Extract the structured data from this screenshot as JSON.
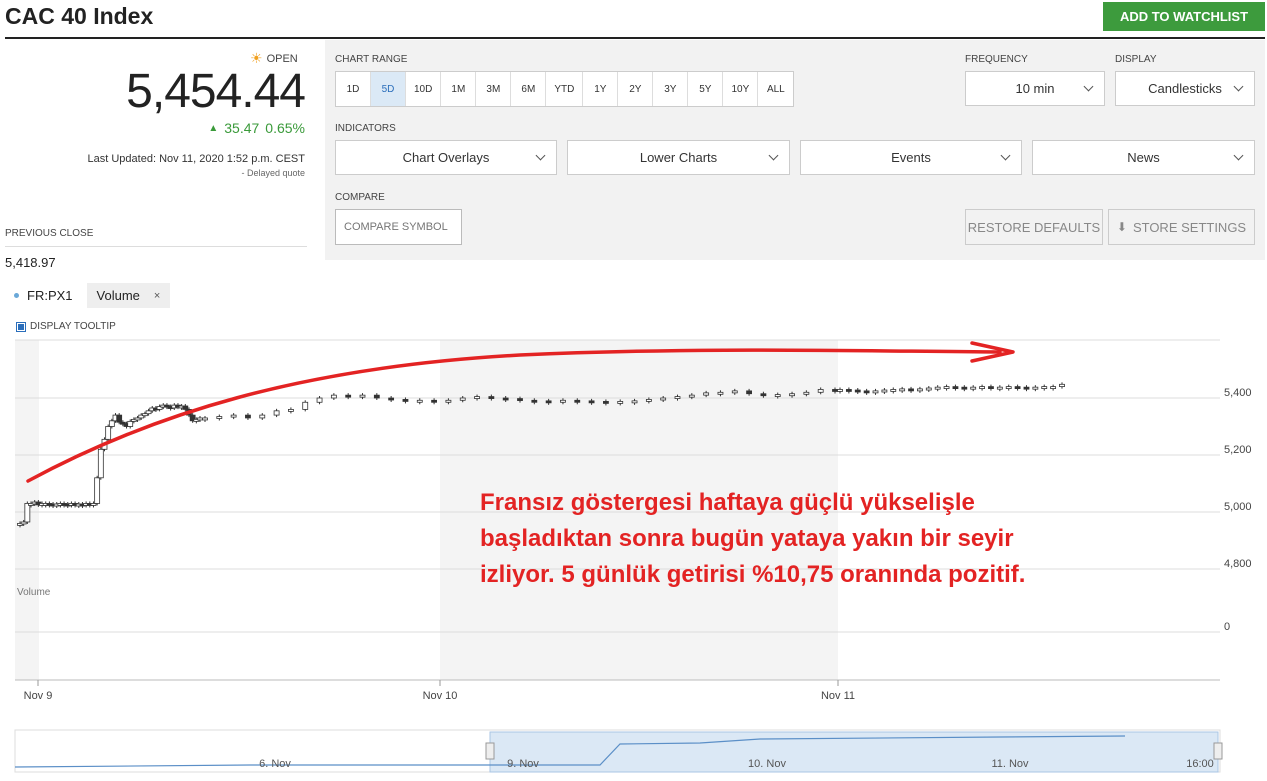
{
  "header": {
    "title": "CAC 40 Index",
    "watchlist_label": "ADD TO WATCHLIST"
  },
  "quote": {
    "status": "OPEN",
    "price": "5,454.44",
    "change": "35.47",
    "change_pct": "0.65%",
    "last_updated": "Last Updated: Nov 11, 2020 1:52 p.m. CEST",
    "delayed": "- Delayed quote",
    "prev_close_label": "PREVIOUS CLOSE",
    "prev_close": "5,418.97"
  },
  "controls": {
    "chart_range_label": "CHART RANGE",
    "ranges": [
      "1D",
      "5D",
      "10D",
      "1M",
      "3M",
      "6M",
      "YTD",
      "1Y",
      "2Y",
      "3Y",
      "5Y",
      "10Y",
      "ALL"
    ],
    "active_range": "5D",
    "frequency_label": "FREQUENCY",
    "frequency": "10 min",
    "display_label": "DISPLAY",
    "display": "Candlesticks",
    "indicators_label": "INDICATORS",
    "indicators": [
      "Chart Overlays",
      "Lower Charts",
      "Events",
      "News"
    ],
    "compare_label": "COMPARE",
    "compare_placeholder": "COMPARE SYMBOL",
    "restore_label": "RESTORE DEFAULTS",
    "store_label": "STORE SETTINGS"
  },
  "legend": {
    "symbol": "FR:PX1",
    "volume": "Volume",
    "close": "×",
    "tooltip": "DISPLAY TOOLTIP"
  },
  "annotation": "Fransız göstergesi haftaya güçlü yükselişle başladıktan sonra bugün yataya yakın bir seyir izliyor. 5 günlük getirisi %10,75 oranında pozitif.",
  "annotation_color": "#e32323",
  "chart_data": {
    "type": "candlestick",
    "y_ticks": [
      "5,400",
      "5,200",
      "5,000",
      "4,800"
    ],
    "ylim": [
      4800,
      5600
    ],
    "x_labels": [
      "Nov 9",
      "Nov 10",
      "Nov 11"
    ],
    "volume_label": "Volume",
    "volume_tick": "0",
    "navigator_labels": [
      "6. Nov",
      "9. Nov",
      "10. Nov",
      "11. Nov",
      "16:00"
    ],
    "series": [
      {
        "name": "Nov 9",
        "values": [
          4960,
          4965,
          5030,
          5030,
          5035,
          5025,
          5030,
          5030,
          5028,
          5025,
          5028,
          5030,
          5028,
          5025,
          5030,
          5026,
          5028,
          5025,
          5030,
          5028,
          5030,
          5120,
          5220,
          5255,
          5300,
          5320,
          5340,
          5315,
          5310,
          5300,
          5318,
          5325,
          5330,
          5340,
          5345,
          5355,
          5365,
          5360,
          5370,
          5375,
          5370,
          5365,
          5375,
          5368,
          5372,
          5360,
          5340,
          5320,
          5325,
          5330
        ]
      },
      {
        "name": "Nov 10",
        "values": [
          5330,
          5335,
          5340,
          5330,
          5340,
          5355,
          5360,
          5385,
          5400,
          5410,
          5405,
          5410,
          5400,
          5395,
          5390,
          5392,
          5388,
          5392,
          5400,
          5405,
          5400,
          5398,
          5392,
          5390,
          5388,
          5392,
          5390,
          5388,
          5385,
          5388,
          5390,
          5395,
          5400,
          5405,
          5410,
          5418,
          5420,
          5425,
          5415,
          5410,
          5412,
          5415,
          5420,
          5430,
          5425
        ]
      },
      {
        "name": "Nov 11",
        "values": [
          5430,
          5428,
          5425,
          5420,
          5425,
          5428,
          5430,
          5432,
          5430,
          5432,
          5435,
          5438,
          5440,
          5438,
          5436,
          5438,
          5440,
          5438,
          5438,
          5440,
          5438,
          5436,
          5438,
          5440,
          5440,
          5448
        ]
      }
    ]
  }
}
